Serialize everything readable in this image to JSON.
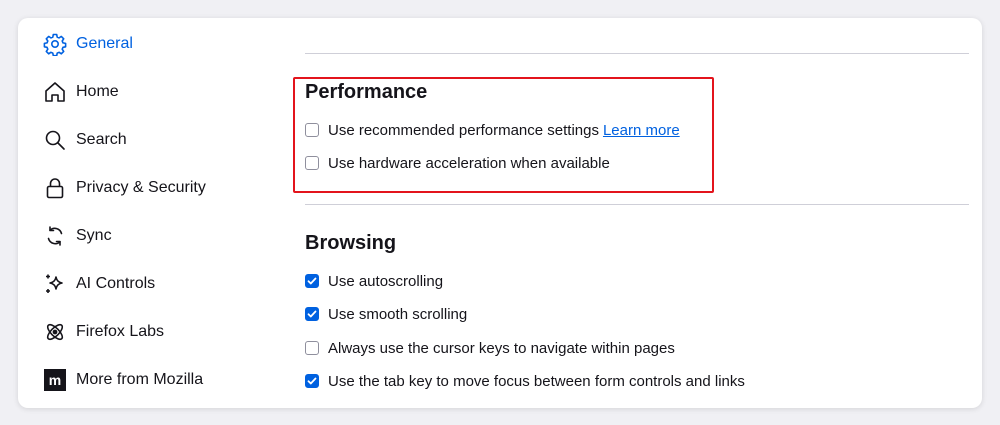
{
  "sidebar": {
    "items": [
      {
        "label": "General",
        "icon": "gear-icon",
        "active": true
      },
      {
        "label": "Home",
        "icon": "home-icon"
      },
      {
        "label": "Search",
        "icon": "search-icon"
      },
      {
        "label": "Privacy & Security",
        "icon": "lock-icon"
      },
      {
        "label": "Sync",
        "icon": "sync-icon"
      },
      {
        "label": "AI Controls",
        "icon": "sparkle-icon"
      },
      {
        "label": "Firefox Labs",
        "icon": "flask-icon"
      },
      {
        "label": "More from Mozilla",
        "icon": "mozilla-icon"
      }
    ]
  },
  "performance": {
    "title": "Performance",
    "options": [
      {
        "label": "Use recommended performance settings",
        "checked": false,
        "link": "Learn more"
      },
      {
        "label": "Use hardware acceleration when available",
        "checked": false
      }
    ]
  },
  "browsing": {
    "title": "Browsing",
    "options": [
      {
        "label": "Use autoscrolling",
        "checked": true
      },
      {
        "label": "Use smooth scrolling",
        "checked": true
      },
      {
        "label": "Always use the cursor keys to navigate within pages",
        "checked": false
      },
      {
        "label": "Use the tab key to move focus between form controls and links",
        "checked": true
      }
    ]
  },
  "colors": {
    "accent": "#0061e0",
    "highlight": "#e3141c"
  }
}
